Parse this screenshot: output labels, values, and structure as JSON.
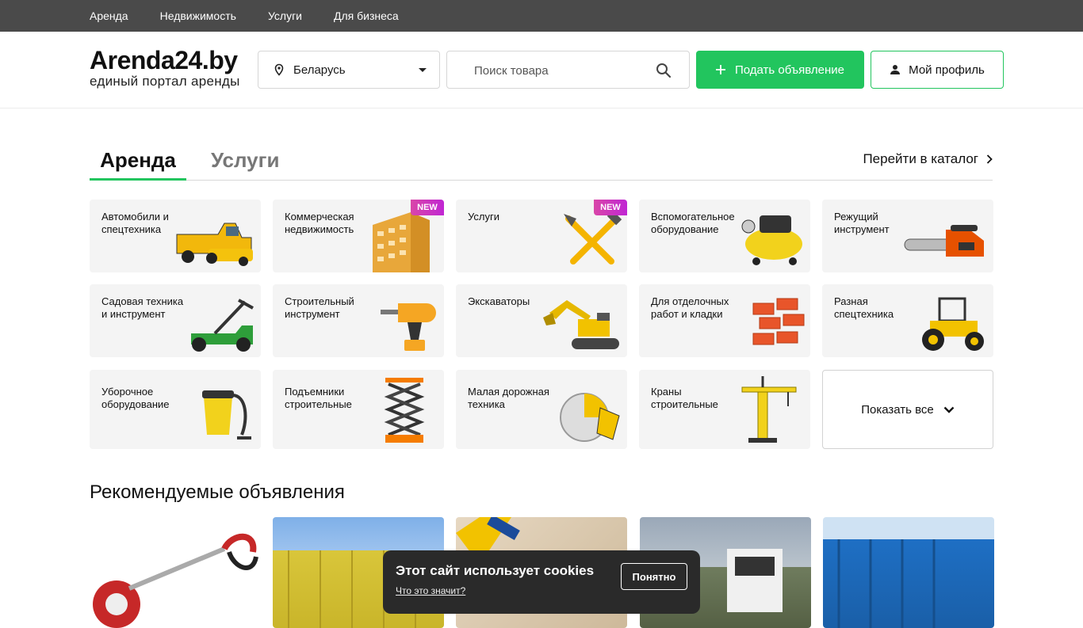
{
  "topnav": [
    "Аренда",
    "Недвижимость",
    "Услуги",
    "Для бизнеса"
  ],
  "header": {
    "logo_name": "Arenda24.by",
    "logo_tagline": "единый портал аренды",
    "region": "Беларусь",
    "search_placeholder": "Поиск товара",
    "post_ad": "Подать объявление",
    "profile": "Мой профиль"
  },
  "tabs": {
    "active": "Аренда",
    "inactive": "Услуги",
    "catalog_link": "Перейти в каталог"
  },
  "categories": [
    {
      "label": "Автомобили и спецтехника",
      "badge": "",
      "icon": "dump-truck-icon"
    },
    {
      "label": "Коммерческая недвижимость",
      "badge": "NEW",
      "icon": "building-icon"
    },
    {
      "label": "Услуги",
      "badge": "NEW",
      "icon": "tools-icon"
    },
    {
      "label": "Вспомогательное оборудование",
      "badge": "",
      "icon": "compressor-icon"
    },
    {
      "label": "Режущий инструмент",
      "badge": "",
      "icon": "chainsaw-icon"
    },
    {
      "label": "Садовая техника и инструмент",
      "badge": "",
      "icon": "lawnmower-icon"
    },
    {
      "label": "Строительный инструмент",
      "badge": "",
      "icon": "drill-icon"
    },
    {
      "label": "Экскаваторы",
      "badge": "",
      "icon": "excavator-icon"
    },
    {
      "label": "Для отделочных работ и кладки",
      "badge": "",
      "icon": "bricks-icon"
    },
    {
      "label": "Разная спецтехника",
      "badge": "",
      "icon": "tractor-icon"
    },
    {
      "label": "Уборочное оборудование",
      "badge": "",
      "icon": "vacuum-icon"
    },
    {
      "label": "Подъемники строительные",
      "badge": "",
      "icon": "scissor-lift-icon"
    },
    {
      "label": "Малая дорожная техника",
      "badge": "",
      "icon": "concrete-saw-icon"
    },
    {
      "label": "Краны строительные",
      "badge": "",
      "icon": "crane-icon"
    }
  ],
  "show_all": "Показать все",
  "recommended_title": "Рекомендуемые объявления",
  "cookie": {
    "message": "Этот сайт использует cookies",
    "more": "Что это значит?",
    "ok": "Понятно"
  },
  "colors": {
    "accent": "#22c55e",
    "badge": "#c026d3",
    "topbar": "#4a4a4a"
  }
}
